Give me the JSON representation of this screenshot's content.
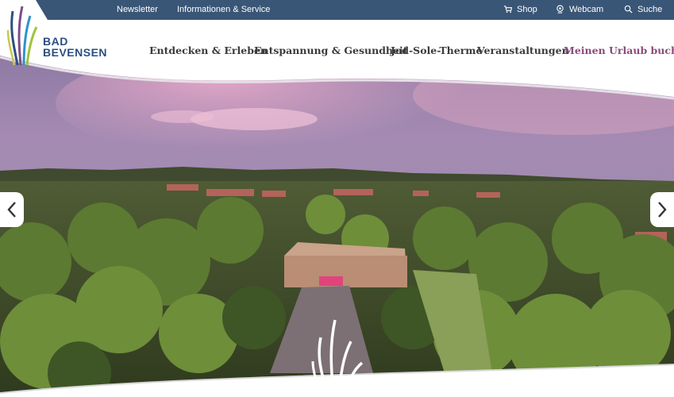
{
  "topbar": {
    "links": [
      "Newsletter",
      "Informationen & Service"
    ],
    "shop": "Shop",
    "webcam": "Webcam",
    "search": "Suche"
  },
  "logo": {
    "line1": "BAD",
    "line2": "BEVENSEN"
  },
  "nav": {
    "items": [
      "Entdecken & Erleben",
      "Entspannung & Gesundheit",
      "Jod-Sole-Therme",
      "Veranstaltungen"
    ],
    "cta": "Meinen Urlaub buchen"
  },
  "colors": {
    "topbar": "#3a5677",
    "brand_blue": "#2b4f82",
    "accent_purple": "#8b4a7c"
  },
  "icons": [
    "cart-icon",
    "webcam-icon",
    "search-icon",
    "chevron-left-icon",
    "chevron-right-icon"
  ]
}
